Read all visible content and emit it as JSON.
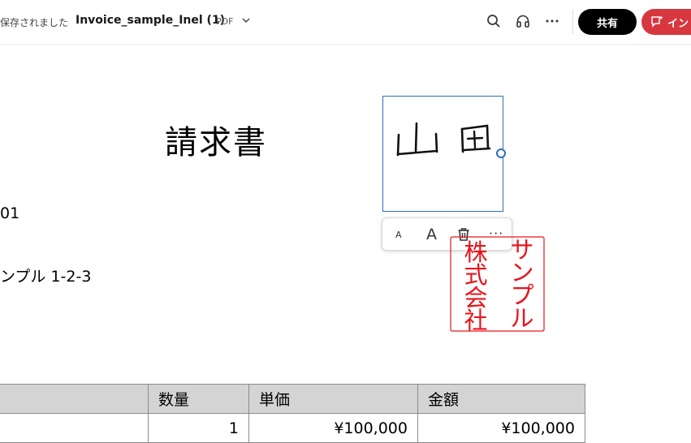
{
  "toolbar": {
    "save_status": "保存されました",
    "doc_title": "Invoice_sample_Inel (1)",
    "doc_type": "PDF",
    "share_label": "共有",
    "invite_label": "イン"
  },
  "document": {
    "heading": "請求書",
    "line_1": "01",
    "line_2": "ンプル 1-2-3",
    "signature_text": "山田",
    "seal_text": [
      "株式会社",
      "サンプル"
    ]
  },
  "mini_toolbar": {
    "small_a": "A",
    "large_a": "A",
    "more": "···"
  },
  "table": {
    "headers": [
      "",
      "数量",
      "単価",
      "金額"
    ],
    "rows": [
      [
        "",
        "1",
        "¥100,000",
        "¥100,000"
      ]
    ]
  },
  "colors": {
    "accent_blue": "#2e6fb6",
    "invite_red": "#d7373f",
    "seal_red": "#e8141c"
  }
}
